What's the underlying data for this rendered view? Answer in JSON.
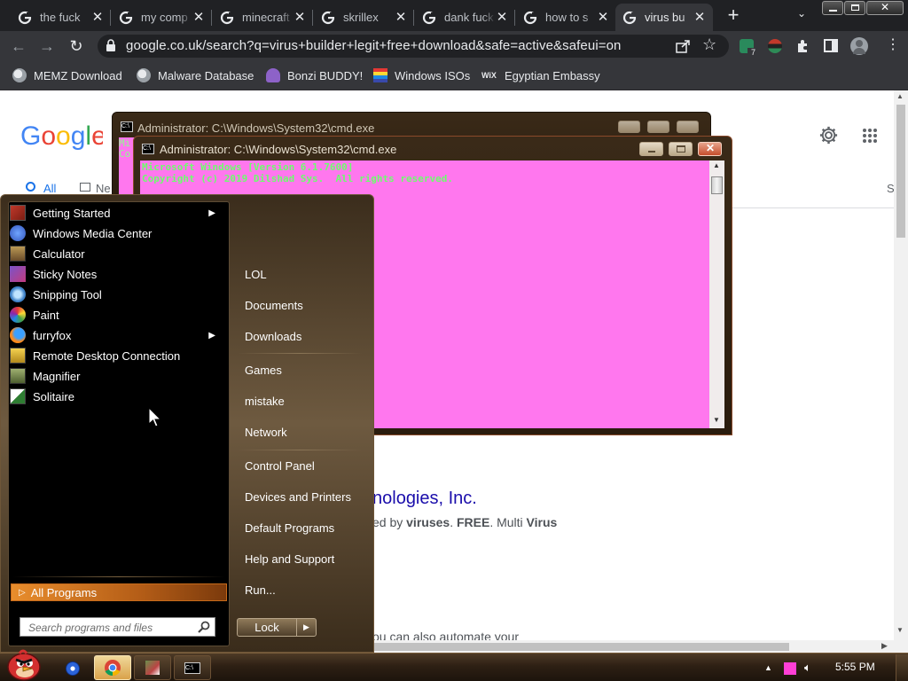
{
  "browser": {
    "tabs": [
      {
        "title": "the fuck"
      },
      {
        "title": "my comp"
      },
      {
        "title": "minecraft"
      },
      {
        "title": "skrillex"
      },
      {
        "title": "dank fuck"
      },
      {
        "title": "how to s"
      },
      {
        "title": "virus bu"
      }
    ],
    "url": "google.co.uk/search?q=virus+builder+legit+free+download&safe=active&safeui=on",
    "bookmarks": [
      "MEMZ Download",
      "Malware Database",
      "Bonzi BUDDY!",
      "Windows ISOs",
      "Egyptian Embassy"
    ],
    "extension_badge": "7"
  },
  "google": {
    "tabs": [
      "All",
      "Ne"
    ],
    "right_cut_text": "S",
    "result_title": "nologies, Inc.",
    "result_snippet_parts": [
      "ed by ",
      "viruses",
      ". ",
      "FREE",
      ". Multi ",
      "Virus"
    ],
    "result_bottom": "ou can also automate your"
  },
  "cmd": {
    "back_title": "Administrator: C:\\Windows\\System32\\cmd.exe",
    "front_title": "Administrator: C:\\Windows\\System32\\cmd.exe",
    "back_peek": [
      "Mi",
      "Co"
    ],
    "line1": "Microsoft Windows [Version 6.1.7600]",
    "line2": "Copyright (c) 2019 Dilshad Sys.  All rights reserved."
  },
  "start_menu": {
    "programs": [
      {
        "label": "Getting Started",
        "submenu": true
      },
      {
        "label": "Windows Media Center",
        "submenu": false
      },
      {
        "label": "Calculator",
        "submenu": false
      },
      {
        "label": "Sticky Notes",
        "submenu": false
      },
      {
        "label": "Snipping Tool",
        "submenu": false
      },
      {
        "label": "Paint",
        "submenu": false
      },
      {
        "label": "furryfox",
        "submenu": true
      },
      {
        "label": "Remote Desktop Connection",
        "submenu": false
      },
      {
        "label": "Magnifier",
        "submenu": false
      },
      {
        "label": "Solitaire",
        "submenu": false
      }
    ],
    "all_programs": "All Programs",
    "search_placeholder": "Search programs and files",
    "right_links": [
      "LOL",
      "Documents",
      "Downloads",
      "Games",
      "mistake",
      "Network",
      "Control Panel",
      "Devices and Printers",
      "Default Programs",
      "Help and Support",
      "Run..."
    ],
    "lock_label": "Lock"
  },
  "taskbar": {
    "clock": "5:55 PM"
  }
}
